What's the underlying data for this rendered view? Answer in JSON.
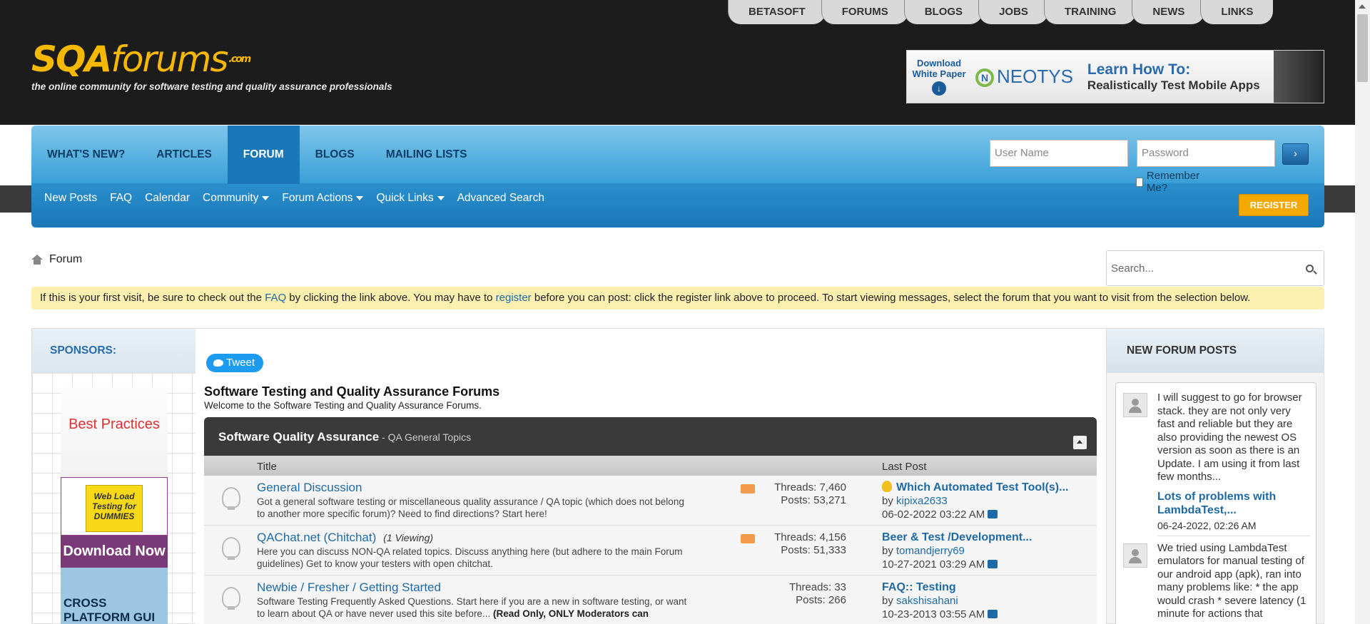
{
  "top_tabs": [
    "BETASOFT",
    "FORUMS",
    "BLOGS",
    "JOBS",
    "TRAINING",
    "NEWS",
    "LINKS"
  ],
  "logo": {
    "sqa": "SQA",
    "forums": "forums",
    "com": ".com",
    "tagline": "the online community for software testing and quality assurance professionals"
  },
  "ad": {
    "download": "Download White Paper",
    "brand": "NEOTYS",
    "line1": "Learn How To:",
    "line2": "Realistically Test Mobile Apps"
  },
  "nav": {
    "tabs": [
      "WHAT'S NEW?",
      "ARTICLES",
      "FORUM",
      "BLOGS",
      "MAILING LISTS"
    ],
    "active": "FORUM",
    "subnav": [
      "New Posts",
      "FAQ",
      "Calendar",
      "Community",
      "Forum Actions",
      "Quick Links",
      "Advanced Search"
    ]
  },
  "login": {
    "username_placeholder": "User Name",
    "password_placeholder": "Password",
    "remember": "Remember Me?",
    "register": "REGISTER"
  },
  "breadcrumb": "Forum",
  "search_placeholder": "Search...",
  "notice": {
    "p1": "If this is your first visit, be sure to check out the ",
    "faq": "FAQ",
    "p2": " by clicking the link above. You may have to ",
    "register": "register",
    "p3": " before you can post: click the register link above to proceed. To start viewing messages, select the forum that you want to visit from the selection below."
  },
  "sponsors": {
    "title": "SPONSORS:",
    "best_practices": "Best Practices",
    "book": "Web Load Testing for DUMMIES",
    "download_now": "Download Now",
    "cross_platform": "CROSS PLATFORM GUI TESTING"
  },
  "main": {
    "tweet": "Tweet",
    "title": "Software Testing and Quality Assurance Forums",
    "subtitle": "Welcome to the Software Testing and Quality Assurance Forums.",
    "category": {
      "name": "Software Quality Assurance",
      "desc": " - QA General Topics"
    },
    "col_title": "Title",
    "col_last": "Last Post",
    "forums": [
      {
        "name": "General Discussion",
        "viewing": "",
        "desc": "Got a general software testing or miscellaneous quality assurance / QA topic (which does not belong to another more specific forum)? Need to find directions? Start here!",
        "desc_bold": "",
        "threads": "Threads: 7,460",
        "posts": "Posts: 53,271",
        "last_title": "Which Automated Test Tool(s)...",
        "last_by": "kipixa2633",
        "last_date": "06-02-2022 03:22 AM"
      },
      {
        "name": "QAChat.net (Chitchat)",
        "viewing": "(1 Viewing)",
        "desc": "Here you can discuss NON-QA related topics. Discuss anything here (but adhere to the main Forum guidelines) Get to know your testers with open chitchat.",
        "desc_bold": "",
        "threads": "Threads: 4,156",
        "posts": "Posts: 51,333",
        "last_title": "Beer & Test /Development...",
        "last_by": "tomandjerry69",
        "last_date": "10-27-2021 03:29 AM"
      },
      {
        "name": "Newbie / Fresher / Getting Started",
        "viewing": "",
        "desc": "Software Testing Frequently Asked Questions. Start here if you are a new in software testing, or want to learn about QA or have never used this site before...",
        "desc_bold": "(Read Only, ONLY Moderators can",
        "threads": "Threads: 33",
        "posts": "Posts: 266",
        "last_title": "FAQ:: Testing",
        "last_by": "sakshisahani",
        "last_date": "10-23-2013 03:55 AM"
      }
    ]
  },
  "new_posts": {
    "title": "NEW FORUM POSTS",
    "items": [
      {
        "text": "I will suggest to go for browser stack. they are not only very fast and reliable but they are also providing the newest OS version as soon as there is an Update. I am using it from last few months...",
        "link": "Lots of problems with LambdaTest,...",
        "date": "06-24-2022, 02:26 AM"
      },
      {
        "text": "We tried using LambdaTest emulators for manual testing of our android app (apk), ran into many problems like: * the app would crash * severe latency (1 minute for actions that"
      }
    ]
  },
  "by_label": "by "
}
